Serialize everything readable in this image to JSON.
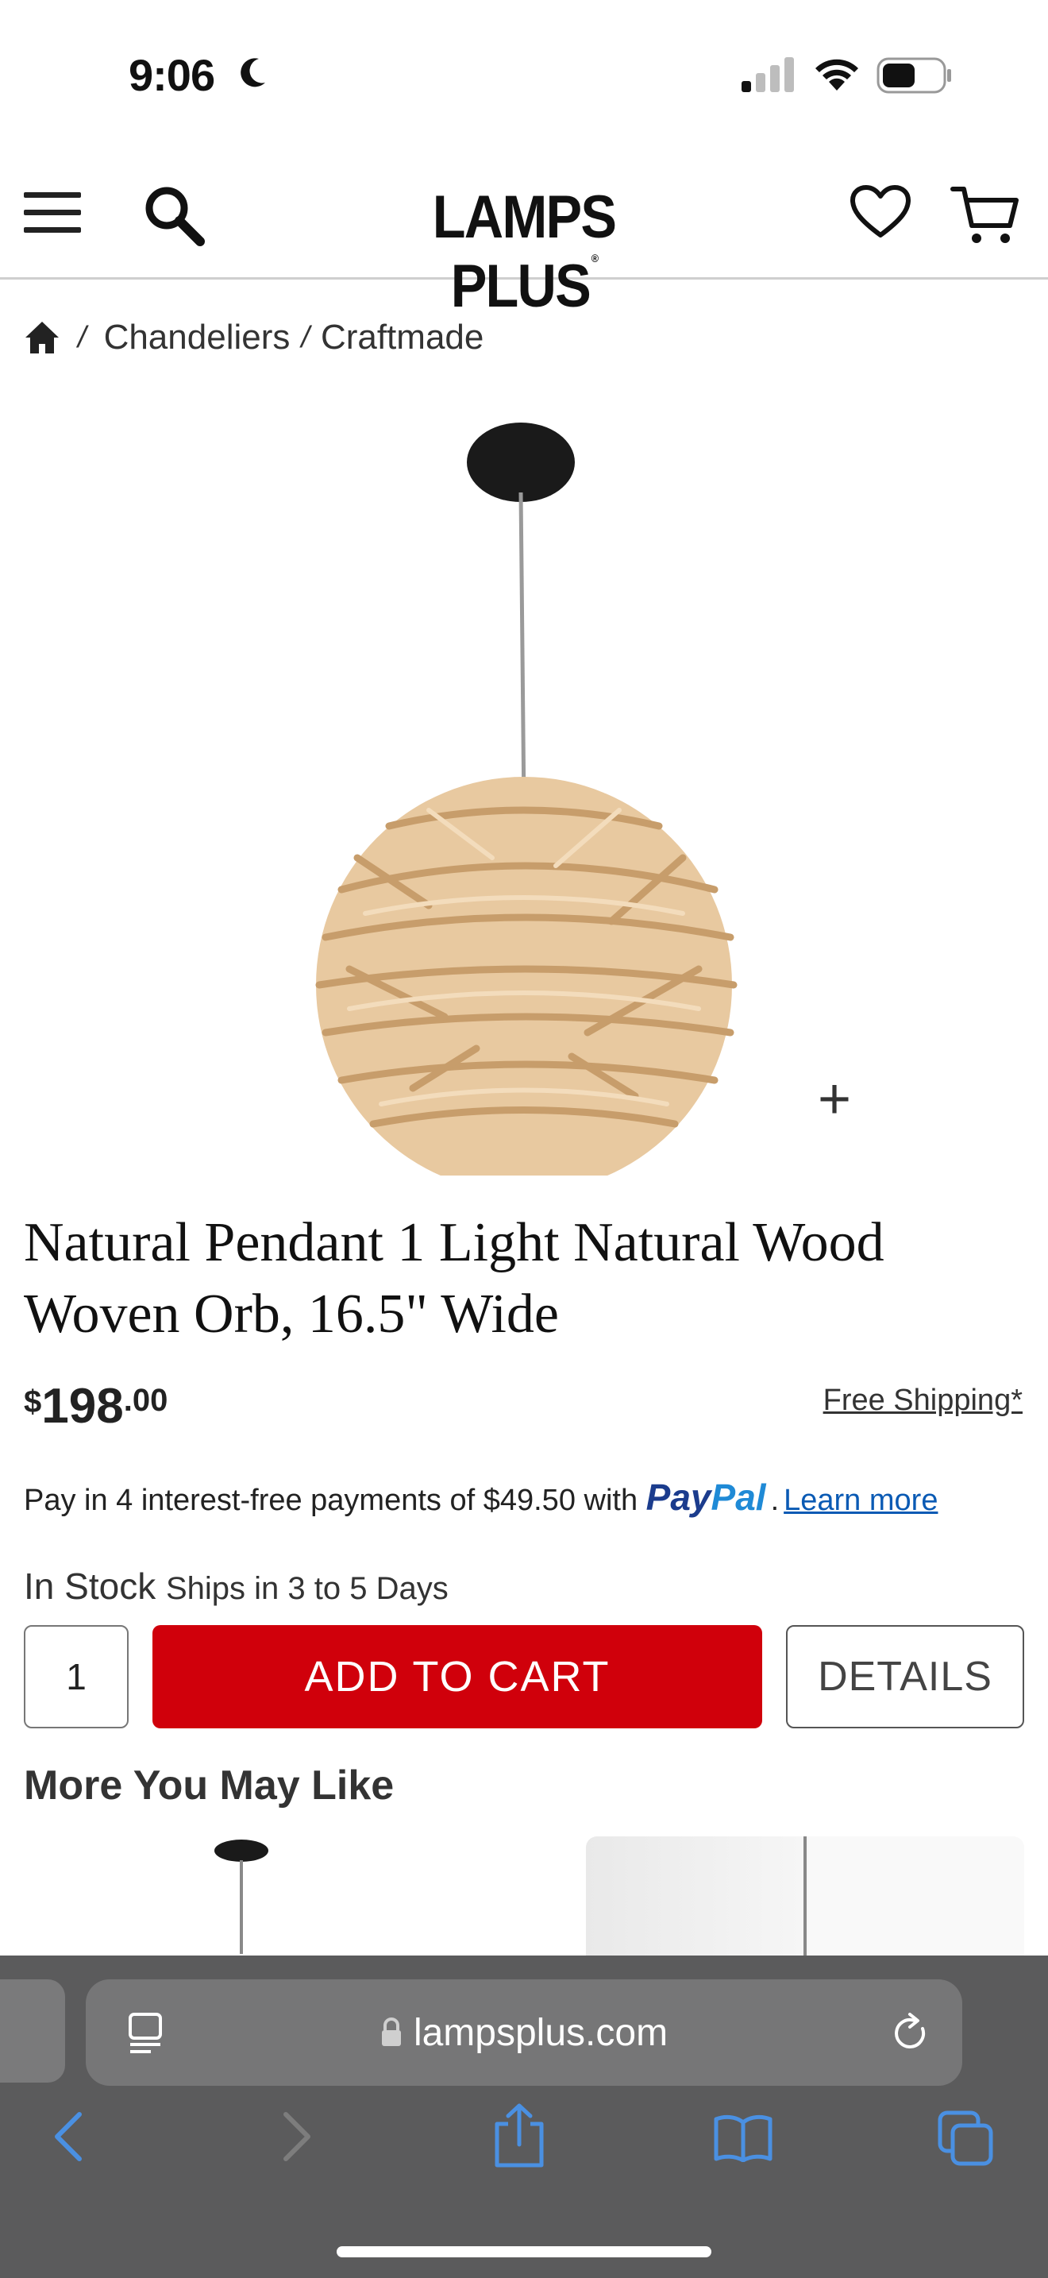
{
  "status_bar": {
    "time": "9:06"
  },
  "header": {
    "logo": "LAMPS PLUS",
    "logo_mark": "®"
  },
  "breadcrumb": {
    "items": [
      "Chandeliers",
      "Craftmade"
    ],
    "separator": "/"
  },
  "product": {
    "title": "Natural Pendant 1 Light Natural Wood Woven Orb, 16.5\" Wide",
    "price_currency": "$",
    "price_dollars": "198",
    "price_cents": ".00",
    "free_shipping": "Free Shipping*",
    "paypal_text": "Pay in 4 interest-free payments of $49.50 with",
    "paypal_logo_pay": "Pay",
    "paypal_logo_pal": "Pal",
    "paypal_learn": "Learn more",
    "paypal_period": ".",
    "stock": "In Stock",
    "ships": "Ships in 3 to 5 Days",
    "quantity": "1",
    "add_to_cart": "ADD TO CART",
    "details": "DETAILS",
    "zoom_glyph": "+"
  },
  "recommendations": {
    "heading": "More You May Like"
  },
  "browser": {
    "url": "lampsplus.com"
  },
  "colors": {
    "add_to_cart": "#d0000b",
    "paypal_blue": "#1b3c8d",
    "paypal_light": "#1f8ad6",
    "link": "#0a5ab4",
    "toolbar": "#5b5b5c",
    "toolbar_icon": "#4a90e2"
  }
}
